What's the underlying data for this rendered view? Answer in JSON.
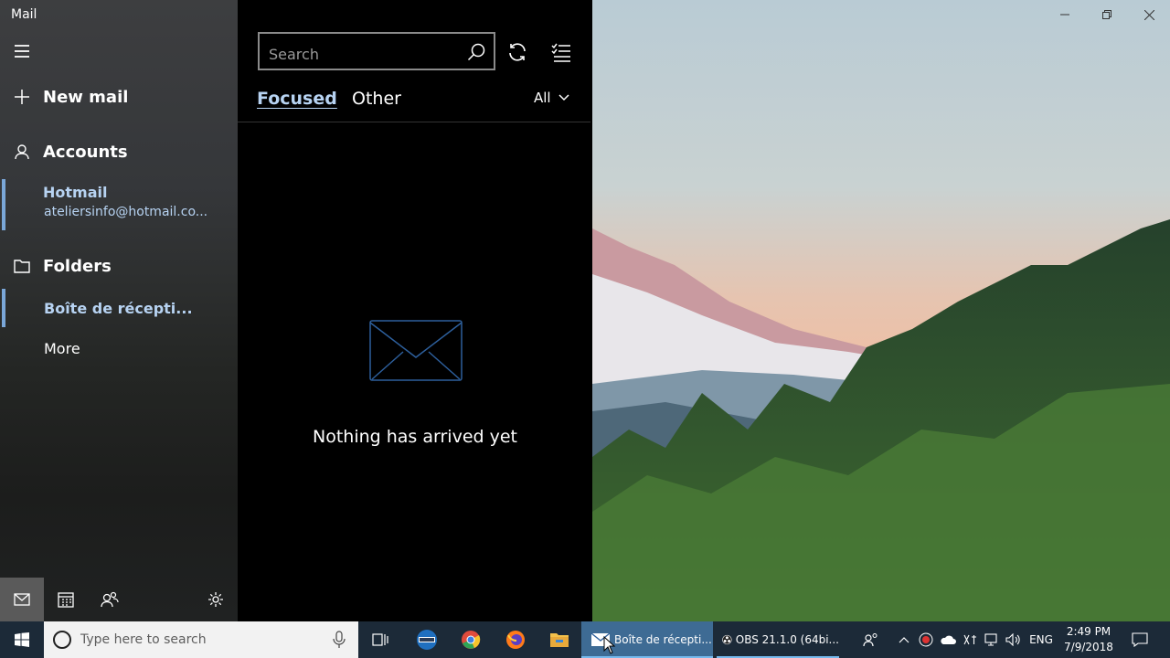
{
  "app": {
    "title": "Mail"
  },
  "sidebar": {
    "new_mail": "New mail",
    "accounts": "Accounts",
    "account": {
      "name": "Hotmail",
      "email": "ateliersinfo@hotmail.co..."
    },
    "folders": "Folders",
    "inbox": "Boîte de récepti...",
    "more": "More"
  },
  "list": {
    "search_placeholder": "Search",
    "tabs": {
      "focused": "Focused",
      "other": "Other"
    },
    "filter": "All",
    "empty_message": "Nothing has arrived yet"
  },
  "taskbar": {
    "search_placeholder": "Type here to search",
    "apps": {
      "mail": "Boîte de récepti...",
      "obs": "OBS 21.1.0 (64bi..."
    },
    "language": "ENG",
    "time": "2:49 PM",
    "date": "7/9/2018"
  },
  "colors": {
    "accent": "#b7d3f2",
    "selection_bar": "#7aa7d8",
    "taskbar": "#1c2a38",
    "taskbar_active": "#3e6b94"
  }
}
